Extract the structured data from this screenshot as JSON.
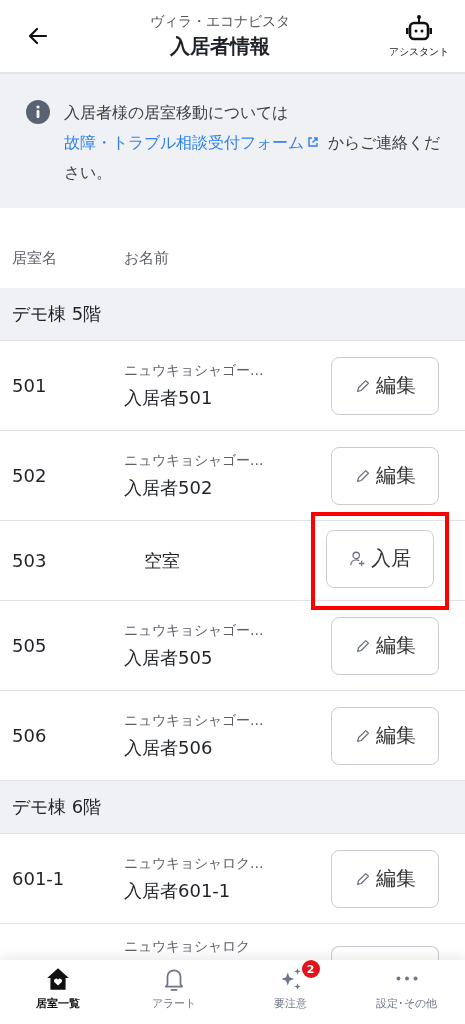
{
  "header": {
    "subtitle": "ヴィラ・エコナビスタ",
    "title": "入居者情報",
    "assistant_label": "アシスタント"
  },
  "notice": {
    "text_before": "入居者様の居室移動については ",
    "link": "故障・トラブル相談受付フォーム",
    "text_after": " からご連絡ください。"
  },
  "table": {
    "columns": [
      "居室名",
      "お名前"
    ],
    "sections": [
      {
        "title": "デモ棟 5階",
        "rows": [
          {
            "kind": "resident",
            "room": "501",
            "kana": "ニュウキョシャゴー...",
            "name": "入居者501",
            "button": "編集",
            "highlighted": false
          },
          {
            "kind": "resident",
            "room": "502",
            "kana": "ニュウキョシャゴー...",
            "name": "入居者502",
            "button": "編集",
            "highlighted": false
          },
          {
            "kind": "vacant",
            "room": "503",
            "name": "空室",
            "button": "入居",
            "highlighted": true
          },
          {
            "kind": "resident",
            "room": "505",
            "kana": "ニュウキョシャゴー...",
            "name": "入居者505",
            "button": "編集",
            "highlighted": false
          },
          {
            "kind": "resident",
            "room": "506",
            "kana": "ニュウキョシャゴー...",
            "name": "入居者506",
            "button": "編集",
            "highlighted": false
          }
        ]
      },
      {
        "title": "デモ棟 6階",
        "rows": [
          {
            "kind": "resident",
            "room": "601-1",
            "kana": "ニュウキョシャロク...",
            "name": "入居者601-1",
            "button": "編集",
            "highlighted": false
          },
          {
            "kind": "partial",
            "kana": "ニュウキョシャロク"
          }
        ]
      }
    ]
  },
  "nav": [
    {
      "label": "居室一覧",
      "selected": true
    },
    {
      "label": "アラート",
      "selected": false
    },
    {
      "label": "要注意",
      "selected": false,
      "badge": "2"
    },
    {
      "label": "設定･その他",
      "selected": false
    }
  ]
}
